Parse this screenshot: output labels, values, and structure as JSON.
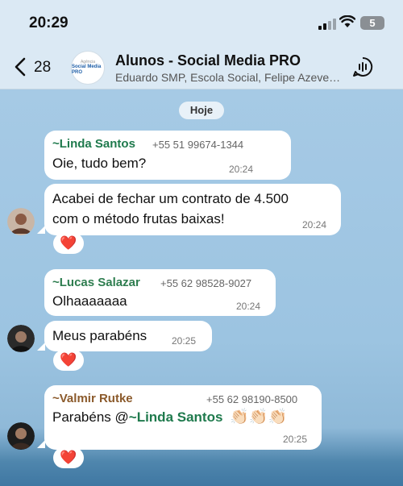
{
  "status": {
    "time": "20:29",
    "battery": "5"
  },
  "header": {
    "back_count": "28",
    "logo_small": "Agência",
    "logo_text": "Social Media PRO",
    "title": "Alunos - Social Media PRO",
    "subtitle": "Eduardo SMP, Escola Social, Felipe Azevedo…"
  },
  "date_separator": "Hoje",
  "colors": {
    "linda": "#1f7a4d",
    "lucas": "#2e7d4f",
    "valmir": "#8b5a2b"
  },
  "messages": [
    {
      "sender": "~Linda Santos",
      "phone": "+55 51 99674-1344",
      "text": "Oie, tudo bem?",
      "time": "20:24"
    },
    {
      "text_line1": "Acabei de fechar um contrato de 4.500",
      "text_line2": "com o método frutas baixas!",
      "time": "20:24",
      "reaction": "❤️"
    },
    {
      "sender": "~Lucas Salazar",
      "phone": "+55 62 98528-9027",
      "text": "Olhaaaaaaa",
      "time": "20:24"
    },
    {
      "text": "Meus parabéns",
      "time": "20:25",
      "reaction": "❤️"
    },
    {
      "sender": "~Valmir Rutke",
      "phone": "+55 62 98190-8500",
      "text_prefix": "Parabéns @",
      "mention": "~Linda Santos",
      "emoji": "👏🏻👏🏻👏🏻",
      "time": "20:25",
      "reaction": "❤️"
    }
  ]
}
